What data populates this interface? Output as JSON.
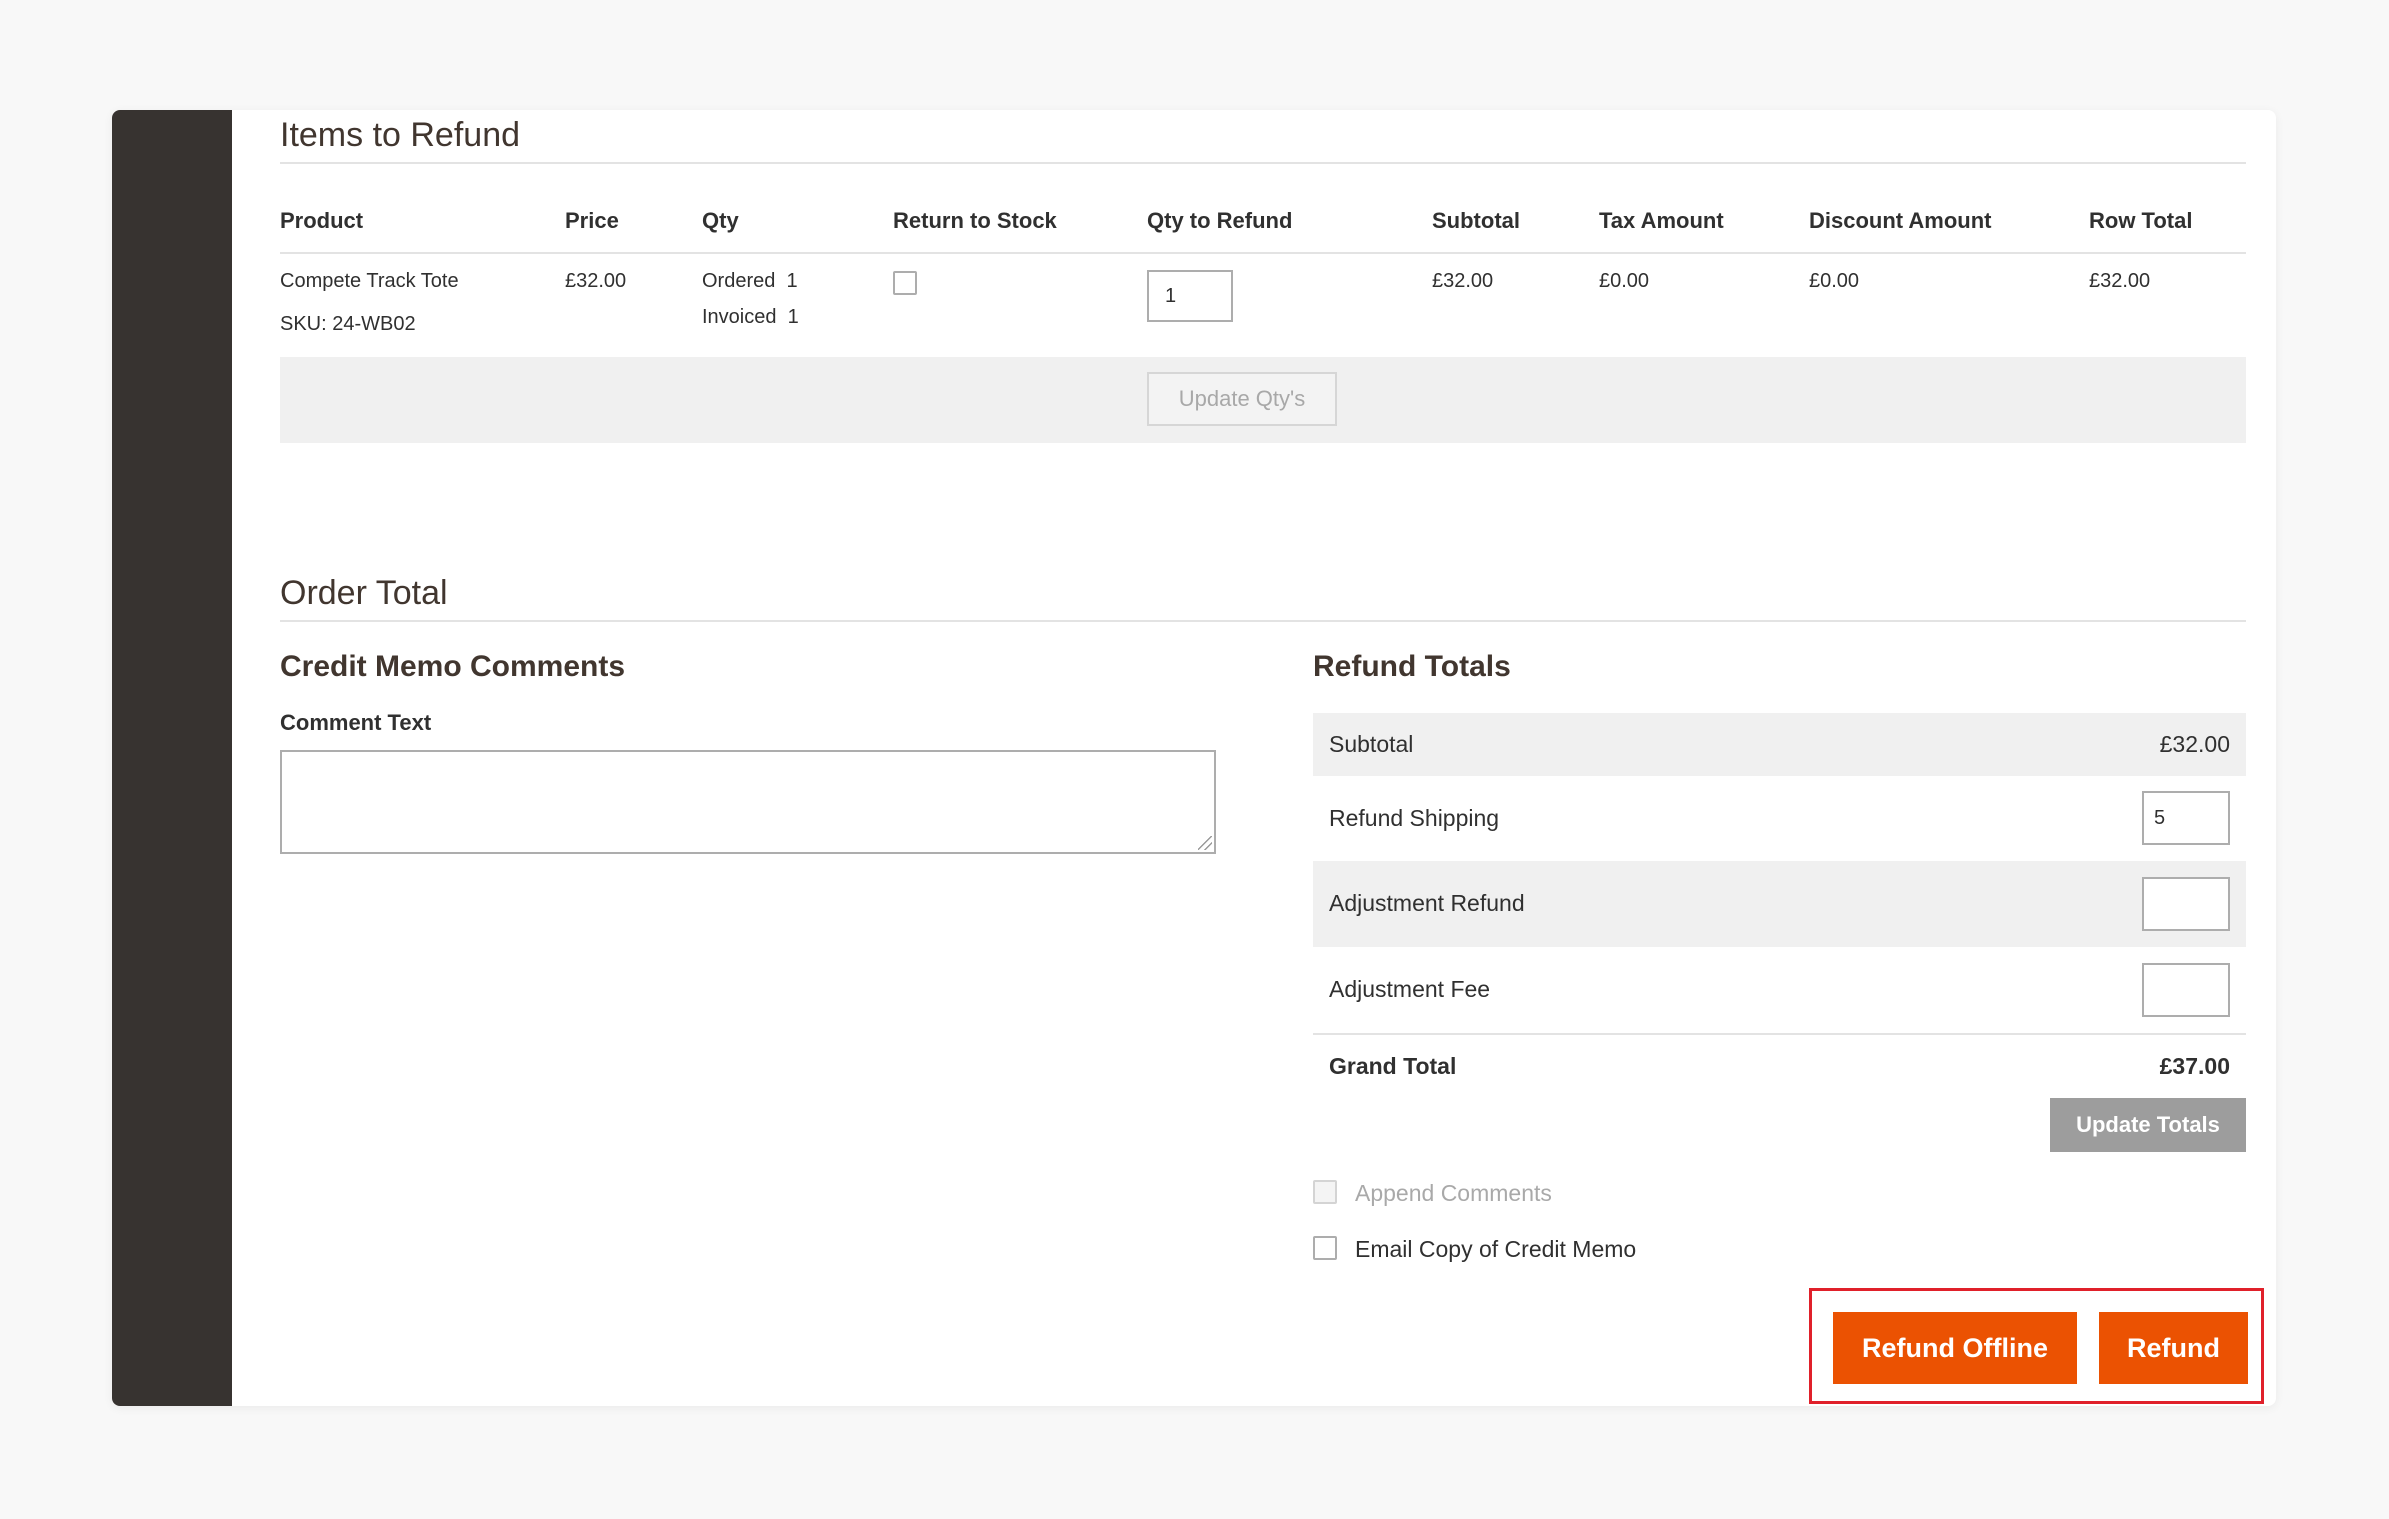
{
  "items_to_refund": {
    "title": "Items to Refund",
    "columns": [
      "Product",
      "Price",
      "Qty",
      "Return to Stock",
      "Qty to Refund",
      "Subtotal",
      "Tax Amount",
      "Discount Amount",
      "Row Total"
    ],
    "rows": [
      {
        "product": "Compete Track Tote",
        "sku": "SKU: 24-WB02",
        "price": "£32.00",
        "qty_ordered": "Ordered  1",
        "qty_invoiced": "Invoiced  1",
        "return_to_stock": false,
        "qty_to_refund": "1",
        "subtotal": "£32.00",
        "tax_amount": "£0.00",
        "discount_amount": "£0.00",
        "row_total": "£32.00"
      }
    ],
    "update_qty_label": "Update Qty's"
  },
  "order_total": {
    "title": "Order Total",
    "comments": {
      "title": "Credit Memo Comments",
      "comment_label": "Comment Text",
      "comment_value": ""
    },
    "refund_totals": {
      "title": "Refund Totals",
      "subtotal_label": "Subtotal",
      "subtotal_value": "£32.00",
      "refund_shipping_label": "Refund Shipping",
      "refund_shipping_value": "5",
      "adjustment_refund_label": "Adjustment Refund",
      "adjustment_refund_value": "",
      "adjustment_fee_label": "Adjustment Fee",
      "adjustment_fee_value": "",
      "grand_total_label": "Grand Total",
      "grand_total_value": "£37.00",
      "update_totals_label": "Update Totals"
    },
    "append_comments_label": "Append Comments",
    "email_copy_label": "Email Copy of Credit Memo"
  },
  "actions": {
    "refund_offline_label": "Refund Offline",
    "refund_label": "Refund"
  },
  "colors": {
    "accent": "#eb5202",
    "highlight_border": "#e0202a",
    "sidebar": "#373330"
  }
}
